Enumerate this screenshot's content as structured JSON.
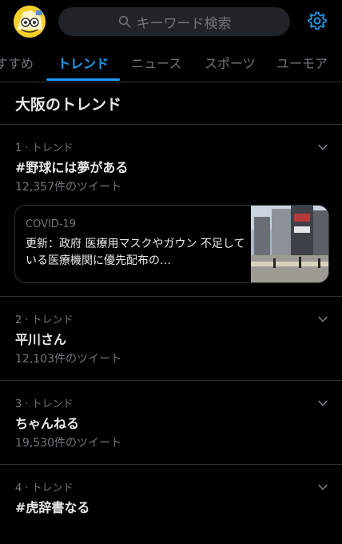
{
  "search": {
    "placeholder": "キーワード検索"
  },
  "tabs": [
    {
      "label": "すすめ"
    },
    {
      "label": "トレンド"
    },
    {
      "label": "ニュース"
    },
    {
      "label": "スポーツ"
    },
    {
      "label": "ユーモア"
    }
  ],
  "section": {
    "title": "大阪のトレンド"
  },
  "trends": [
    {
      "meta": "1 · トレンド",
      "name": "#野球には夢がある",
      "count": "12,357件のツイート"
    },
    {
      "meta": "2 · トレンド",
      "name": "平川さん",
      "count": "12,103件のツイート"
    },
    {
      "meta": "3 · トレンド",
      "name": "ちゃんねる",
      "count": "19,530件のツイート"
    },
    {
      "meta": "4 · トレンド",
      "name": "#虎辞書なる",
      "count": ""
    }
  ],
  "news_card": {
    "label": "COVID-19",
    "text": "更新：政府 医療用マスクやガウン 不足している医療機関に優先配布の…"
  },
  "colors": {
    "accent": "#1d9bf0",
    "background": "#000000",
    "muted": "#71767b"
  }
}
